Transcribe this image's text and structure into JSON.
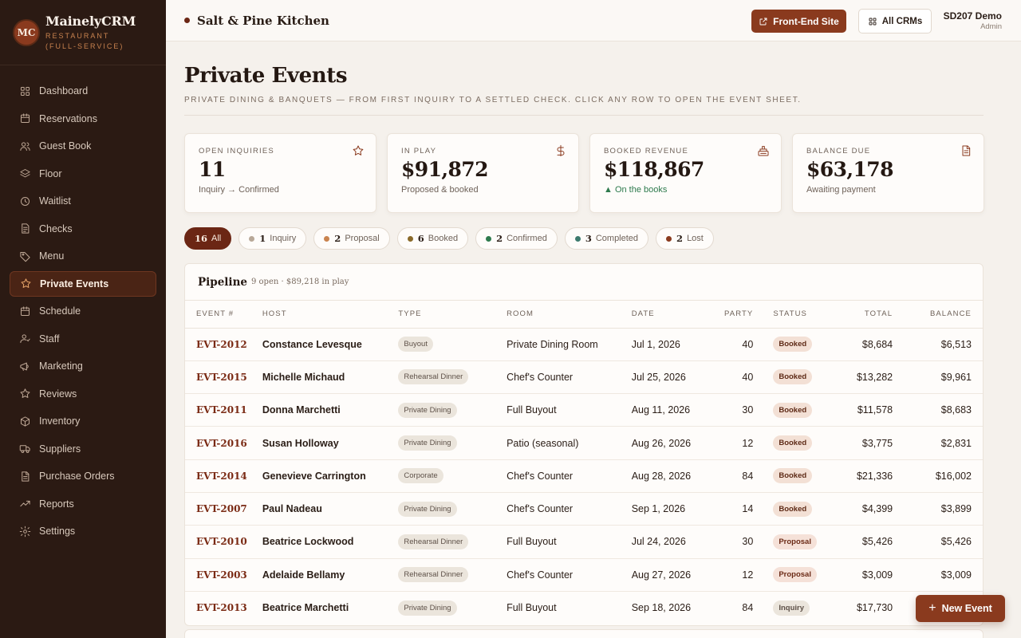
{
  "brand": {
    "logo": "MC",
    "name": "MainelyCRM",
    "sub": "Restaurant (Full-Service)"
  },
  "nav": [
    {
      "label": "Dashboard",
      "icon": "grid-icon"
    },
    {
      "label": "Reservations",
      "icon": "calendar-icon"
    },
    {
      "label": "Guest Book",
      "icon": "users-icon"
    },
    {
      "label": "Floor",
      "icon": "floor-icon"
    },
    {
      "label": "Waitlist",
      "icon": "clock-icon"
    },
    {
      "label": "Checks",
      "icon": "receipt-icon"
    },
    {
      "label": "Menu",
      "icon": "tag-icon"
    },
    {
      "label": "Private Events",
      "icon": "star-icon",
      "active": true
    },
    {
      "label": "Schedule",
      "icon": "calendar-icon"
    },
    {
      "label": "Staff",
      "icon": "staff-icon"
    },
    {
      "label": "Marketing",
      "icon": "megaphone-icon"
    },
    {
      "label": "Reviews",
      "icon": "star-icon"
    },
    {
      "label": "Inventory",
      "icon": "box-icon"
    },
    {
      "label": "Suppliers",
      "icon": "truck-icon"
    },
    {
      "label": "Purchase Orders",
      "icon": "document-icon"
    },
    {
      "label": "Reports",
      "icon": "trend-icon"
    },
    {
      "label": "Settings",
      "icon": "gear-icon"
    }
  ],
  "topbar": {
    "venue": "Salt & Pine Kitchen",
    "front_end_label": "Front-End Site",
    "all_crms_label": "All CRMs",
    "user_name": "SD207 Demo",
    "user_role": "Admin"
  },
  "page": {
    "title": "Private Events",
    "subtitle": "Private dining & banquets — from first inquiry to a settled check. Click any row to open the event sheet."
  },
  "kpis": [
    {
      "label": "Open Inquiries",
      "value": "11",
      "sub": "Inquiry → Confirmed",
      "icon": "star-icon"
    },
    {
      "label": "In Play",
      "value": "$91,872",
      "sub": "Proposed & booked",
      "icon": "dollar-icon"
    },
    {
      "label": "Booked Revenue",
      "value": "$118,867",
      "sub": "▲ On the books",
      "icon": "register-icon",
      "positive": true
    },
    {
      "label": "Balance Due",
      "value": "$63,178",
      "sub": "Awaiting payment",
      "icon": "document-icon"
    }
  ],
  "filters": [
    {
      "count": "16",
      "label": "All",
      "active": true,
      "color": ""
    },
    {
      "count": "1",
      "label": "Inquiry",
      "color": "#b8a898"
    },
    {
      "count": "2",
      "label": "Proposal",
      "color": "#c9834f"
    },
    {
      "count": "6",
      "label": "Booked",
      "color": "#8a6a2a"
    },
    {
      "count": "2",
      "label": "Confirmed",
      "color": "#2e7a4d"
    },
    {
      "count": "3",
      "label": "Completed",
      "color": "#3d7a6e"
    },
    {
      "count": "2",
      "label": "Lost",
      "color": "#8a3a1e"
    }
  ],
  "table": {
    "title": "Pipeline",
    "meta": "9 open · $89,218 in play",
    "columns": [
      "Event #",
      "Host",
      "Type",
      "Room",
      "Date",
      "Party",
      "Status",
      "Total",
      "Balance"
    ],
    "rows": [
      {
        "id": "EVT-2012",
        "host": "Constance Levesque",
        "type": "Buyout",
        "room": "Private Dining Room",
        "date": "Jul 1, 2026",
        "party": "40",
        "status": "Booked",
        "total": "$8,684",
        "balance": "$6,513"
      },
      {
        "id": "EVT-2015",
        "host": "Michelle Michaud",
        "type": "Rehearsal Dinner",
        "room": "Chef's Counter",
        "date": "Jul 25, 2026",
        "party": "40",
        "status": "Booked",
        "total": "$13,282",
        "balance": "$9,961"
      },
      {
        "id": "EVT-2011",
        "host": "Donna Marchetti",
        "type": "Private Dining",
        "room": "Full Buyout",
        "date": "Aug 11, 2026",
        "party": "30",
        "status": "Booked",
        "total": "$11,578",
        "balance": "$8,683"
      },
      {
        "id": "EVT-2016",
        "host": "Susan Holloway",
        "type": "Private Dining",
        "room": "Patio (seasonal)",
        "date": "Aug 26, 2026",
        "party": "12",
        "status": "Booked",
        "total": "$3,775",
        "balance": "$2,831"
      },
      {
        "id": "EVT-2014",
        "host": "Genevieve Carrington",
        "type": "Corporate",
        "room": "Chef's Counter",
        "date": "Aug 28, 2026",
        "party": "84",
        "status": "Booked",
        "total": "$21,336",
        "balance": "$16,002"
      },
      {
        "id": "EVT-2007",
        "host": "Paul Nadeau",
        "type": "Private Dining",
        "room": "Chef's Counter",
        "date": "Sep 1, 2026",
        "party": "14",
        "status": "Booked",
        "total": "$4,399",
        "balance": "$3,899"
      },
      {
        "id": "EVT-2010",
        "host": "Beatrice Lockwood",
        "type": "Rehearsal Dinner",
        "room": "Full Buyout",
        "date": "Jul 24, 2026",
        "party": "30",
        "status": "Proposal",
        "total": "$5,426",
        "balance": "$5,426"
      },
      {
        "id": "EVT-2003",
        "host": "Adelaide Bellamy",
        "type": "Rehearsal Dinner",
        "room": "Chef's Counter",
        "date": "Aug 27, 2026",
        "party": "12",
        "status": "Proposal",
        "total": "$3,009",
        "balance": "$3,009"
      },
      {
        "id": "EVT-2013",
        "host": "Beatrice Marchetti",
        "type": "Private Dining",
        "room": "Full Buyout",
        "date": "Sep 18, 2026",
        "party": "84",
        "status": "Inquiry",
        "total": "$17,730",
        "balance": ""
      }
    ]
  },
  "fab": {
    "label": "New Event"
  }
}
